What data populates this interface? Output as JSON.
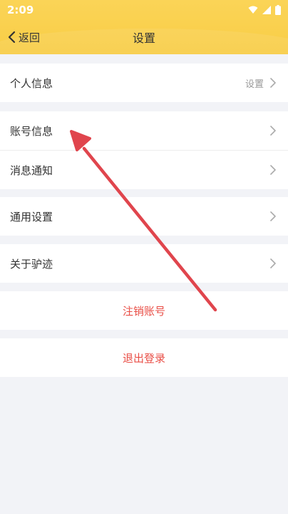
{
  "status_bar": {
    "time": "2:09"
  },
  "nav": {
    "back_label": "返回",
    "title": "设置"
  },
  "settings": {
    "personal_info": {
      "label": "个人信息",
      "hint": "设置"
    },
    "account_info": {
      "label": "账号信息"
    },
    "notifications": {
      "label": "消息通知"
    },
    "general": {
      "label": "通用设置"
    },
    "about": {
      "label": "关于驴迹"
    }
  },
  "actions": {
    "cancel_account": "注销账号",
    "logout": "退出登录"
  },
  "colors": {
    "header": "#f8cd45",
    "danger": "#e94e46",
    "arrow": "#e0454d",
    "background": "#f2f3f7"
  }
}
